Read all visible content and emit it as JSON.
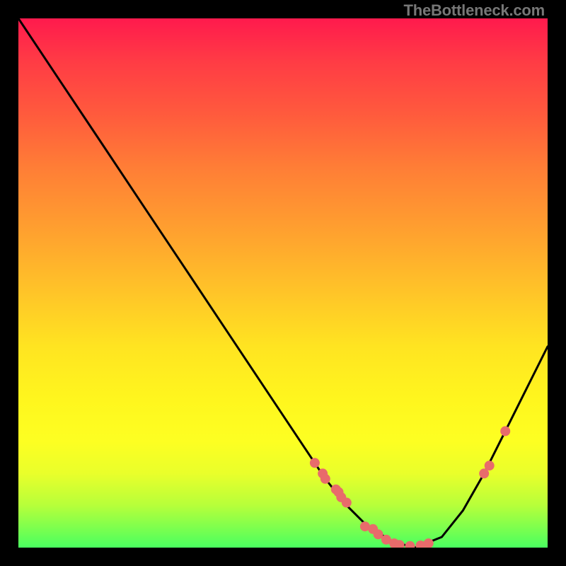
{
  "watermark": "TheBottleneck.com",
  "chart_data": {
    "type": "line",
    "title": "",
    "xlabel": "",
    "ylabel": "",
    "xlim": [
      0,
      100
    ],
    "ylim": [
      0,
      100
    ],
    "series": [
      {
        "name": "curve",
        "x": [
          0,
          8,
          16,
          24,
          32,
          40,
          48,
          54,
          58,
          62,
          66,
          71,
          75,
          80,
          84,
          88,
          92,
          96,
          100
        ],
        "values": [
          100,
          88,
          76,
          64,
          52,
          40,
          28,
          19,
          13,
          8,
          4,
          1,
          0,
          2,
          7,
          14,
          22,
          30,
          38
        ]
      }
    ],
    "markers": {
      "name": "highlight-points",
      "color": "#e86b6b",
      "x": [
        56,
        57.5,
        58,
        60,
        60.5,
        61,
        62,
        65.5,
        67,
        68,
        69.5,
        71,
        72,
        74,
        76,
        77.5,
        88,
        89,
        92
      ],
      "values": [
        16,
        14,
        13,
        11,
        10.5,
        9.5,
        8.5,
        4.0,
        3.5,
        2.5,
        1.5,
        0.8,
        0.5,
        0.3,
        0.4,
        0.8,
        14,
        15.5,
        22
      ]
    },
    "gradient_stops": [
      {
        "pos": 0,
        "color": "#ff1a4d"
      },
      {
        "pos": 0.5,
        "color": "#ffc528"
      },
      {
        "pos": 0.8,
        "color": "#fdff22"
      },
      {
        "pos": 1.0,
        "color": "#4aff60"
      }
    ]
  }
}
